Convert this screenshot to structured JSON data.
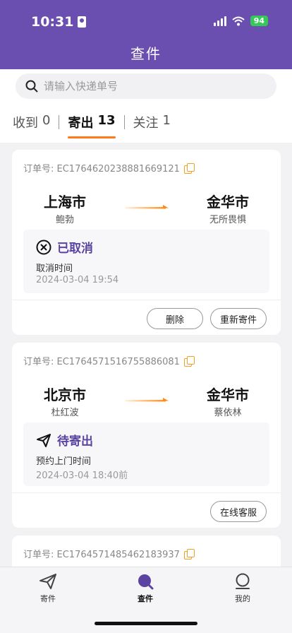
{
  "status_bar": {
    "time": "10:31",
    "battery": "94"
  },
  "header": {
    "title": "查件"
  },
  "search": {
    "placeholder": "请输入快递单号"
  },
  "tabs": [
    {
      "label": "收到",
      "count": "0"
    },
    {
      "label": "寄出",
      "count": "13"
    },
    {
      "label": "关注",
      "count": "1"
    }
  ],
  "orders": [
    {
      "order_no": "订单号: EC1764620238881669121",
      "from_city": "上海市",
      "from_name": "鲍勃",
      "to_city": "金华市",
      "to_name": "无所畏惧",
      "status": "已取消",
      "status_label": "取消时间",
      "status_time": "2024-03-04 19:54",
      "buttons": [
        "删除",
        "重新寄件"
      ]
    },
    {
      "order_no": "订单号: EC1764571516755886081",
      "from_city": "北京市",
      "from_name": "杜红波",
      "to_city": "金华市",
      "to_name": "蔡依林",
      "status": "待寄出",
      "status_label": "预约上门时间",
      "status_time": "2024-03-04 18:40前",
      "buttons": [
        "在线客服"
      ]
    },
    {
      "order_no": "订单号: EC1764571485462183937"
    }
  ],
  "tabbar": [
    {
      "label": "寄件",
      "icon": "send-icon"
    },
    {
      "label": "查件",
      "icon": "search-icon"
    },
    {
      "label": "我的",
      "icon": "profile-icon"
    }
  ],
  "colors": {
    "header": "#6b4fb0",
    "accent": "#ff7a1a",
    "status": "#5b43a3"
  }
}
